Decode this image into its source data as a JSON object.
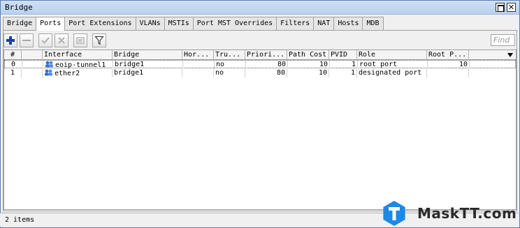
{
  "window": {
    "title": "Bridge"
  },
  "tabs": [
    {
      "label": "Bridge",
      "active": false
    },
    {
      "label": "Ports",
      "active": true
    },
    {
      "label": "Port Extensions",
      "active": false
    },
    {
      "label": "VLANs",
      "active": false
    },
    {
      "label": "MSTIs",
      "active": false
    },
    {
      "label": "Port MST Overrides",
      "active": false
    },
    {
      "label": "Filters",
      "active": false
    },
    {
      "label": "NAT",
      "active": false
    },
    {
      "label": "Hosts",
      "active": false
    },
    {
      "label": "MDB",
      "active": false
    }
  ],
  "toolbar": {
    "buttons": [
      "add-icon",
      "remove-icon",
      "enable-icon",
      "disable-icon",
      "comment-icon",
      "filter-icon"
    ]
  },
  "search": {
    "placeholder": "Find"
  },
  "table": {
    "columns": [
      "#",
      "",
      "Interface",
      "Bridge",
      "Hor...",
      "Tru...",
      "Priori...",
      "Path Cost",
      "PVID",
      "Role",
      "Root P..."
    ],
    "rows": [
      {
        "index": "0",
        "flag": "",
        "interface": "eoip-tunnel1",
        "bridge": "bridge1",
        "horizon": "",
        "trusted": "no",
        "priority": "80",
        "path_cost": "10",
        "pvid": "1",
        "role": "root port",
        "root_path_cost": "10",
        "selected": true
      },
      {
        "index": "1",
        "flag": "",
        "interface": "ether2",
        "bridge": "bridge1",
        "horizon": "",
        "trusted": "no",
        "priority": "80",
        "path_cost": "10",
        "pvid": "1",
        "role": "designated port",
        "root_path_cost": "",
        "selected": false
      }
    ]
  },
  "status": {
    "item_count": "2 items"
  },
  "watermark": {
    "text": "MaskTT.com",
    "badge_letter": "T",
    "badge_color": "#1e88e5"
  },
  "colors": {
    "add": "#1a3fa6",
    "titlebar": "#c4d8f0"
  }
}
